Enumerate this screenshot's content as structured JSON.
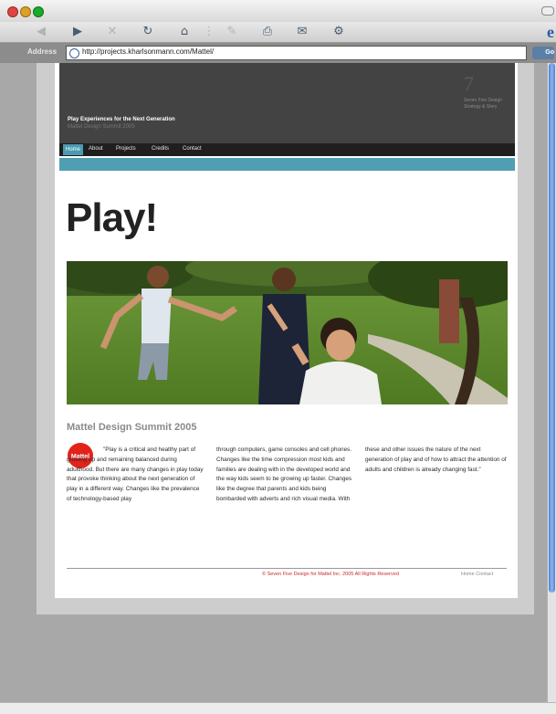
{
  "browser": {
    "address_label": "Address",
    "url": "http://projects.kharlsonmann.com/Mattel/",
    "go_label": "Go",
    "colors": {
      "traffic_red": "#e0443e",
      "traffic_yellow": "#dea123",
      "traffic_green": "#1aab29",
      "accent_blue": "#2c5c9c"
    },
    "toolbar_icons": [
      "back-icon",
      "forward-icon",
      "stop-icon",
      "refresh-icon",
      "home-icon",
      "autofill-icon",
      "print-icon",
      "mail-icon",
      "settings-icon"
    ]
  },
  "site": {
    "tagline": "Play Experiences for the Next Generation",
    "subtag": "Mattel Design Summit 2005",
    "logo_mark": "7",
    "header_blurb": "Seven Five Design Strategy & Story",
    "nav": [
      "Home",
      "About",
      "Projects",
      "Credits",
      "Contact"
    ],
    "accent_color": "#4e9fb1"
  },
  "main": {
    "headline": "Play!",
    "section_title": "Mattel Design Summit 2005",
    "brand_logo_text": "Mattel",
    "col1": "\"Play is a critical and healthy part of growing up and remaining balanced during adulthood. But there are many changes in play today that provoke thinking about the next generation of play in a different way. Changes like the prevalence of technology-based play",
    "col2": "through computers, game consoles and cell phones. Changes like the time compression most kids and families are dealing with in the developed world and the way kids seem to be growing up faster. Changes like the degree that parents and kids being bombarded with adverts and rich visual media. With",
    "col3": "these and other issues the nature of the next generation of play and of how to attract the attention of adults and children is already changing fast.\""
  },
  "footer": {
    "copyright": "© Seven Five Design for Mattel Inc. 2005 All Rights Reserved",
    "links": "Home  Contact"
  }
}
